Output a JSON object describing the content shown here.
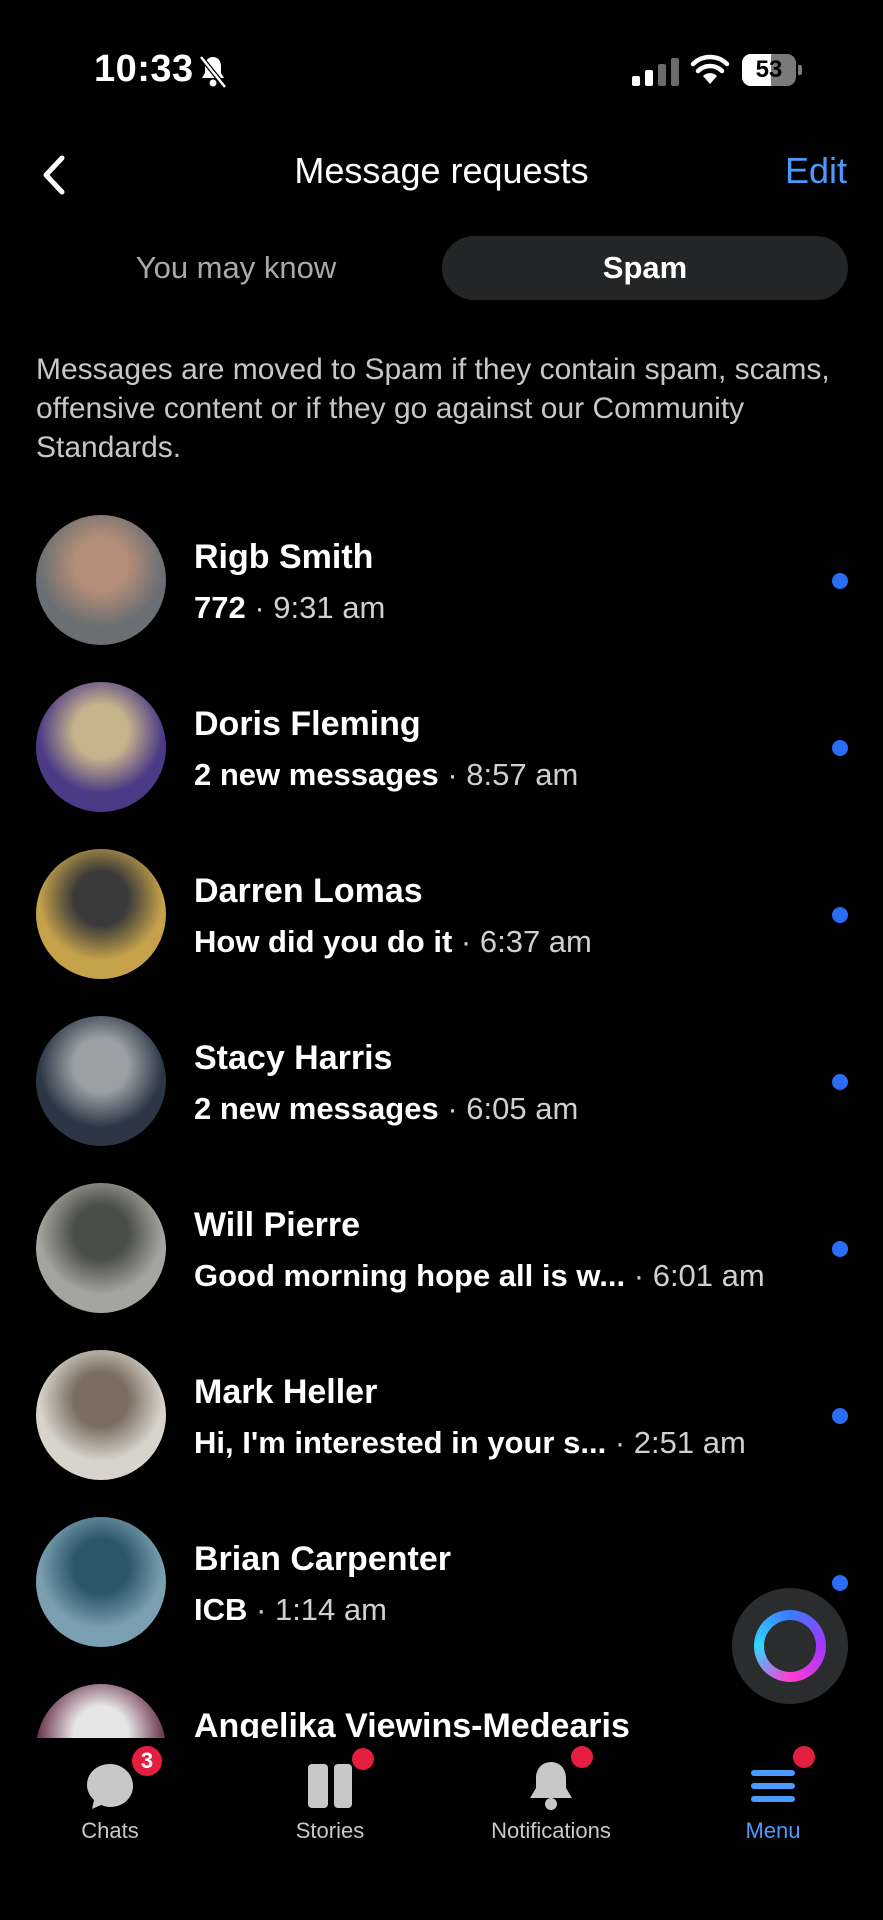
{
  "status": {
    "time": "10:33",
    "battery": "53",
    "battery_level": 0.53
  },
  "header": {
    "title": "Message requests",
    "edit_label": "Edit"
  },
  "tabs": {
    "left": "You may know",
    "right": "Spam"
  },
  "notice": "Messages are moved to Spam if they contain spam, scams, offensive content or if they go against our Community Standards.",
  "conversations": [
    {
      "name": "Rigb Smith",
      "preview": "772",
      "time": "9:31 am",
      "unread": true,
      "avatar_colors": [
        "#6b6f73",
        "#b38d77"
      ]
    },
    {
      "name": "Doris Fleming",
      "preview": "2 new messages",
      "time": "8:57 am",
      "unread": true,
      "avatar_colors": [
        "#4b3a86",
        "#c6b38b"
      ]
    },
    {
      "name": "Darren Lomas",
      "preview": "How did you do it",
      "time": "6:37 am",
      "unread": true,
      "avatar_colors": [
        "#c5a24a",
        "#3a3a3a"
      ]
    },
    {
      "name": "Stacy Harris",
      "preview": "2 new messages",
      "time": "6:05 am",
      "unread": true,
      "avatar_colors": [
        "#2c3645",
        "#9aa1a6"
      ]
    },
    {
      "name": "Will Pierre",
      "preview": "Good morning hope all is w...",
      "time": "6:01 am",
      "unread": true,
      "avatar_colors": [
        "#a4a4a0",
        "#4a4e44"
      ]
    },
    {
      "name": "Mark Heller",
      "preview": "Hi,  I'm interested in your s...",
      "time": "2:51 am",
      "unread": true,
      "avatar_colors": [
        "#d8d4cc",
        "#7b6d61"
      ]
    },
    {
      "name": "Brian Carpenter",
      "preview": "ICB",
      "time": "1:14 am",
      "unread": true,
      "avatar_colors": [
        "#7a9fb0",
        "#2b5568"
      ]
    },
    {
      "name": "Angelika Viewins-Medearis",
      "preview": "",
      "time": "",
      "unread": false,
      "avatar_colors": [
        "#6e3a52",
        "#e6e6e6"
      ]
    }
  ],
  "nav": {
    "chats": {
      "label": "Chats",
      "badge": "3"
    },
    "stories": {
      "label": "Stories"
    },
    "notifications": {
      "label": "Notifications"
    },
    "menu": {
      "label": "Menu"
    }
  },
  "colors": {
    "accent": "#4b9bff",
    "unread_dot": "#2a6cf6",
    "badge": "#e41e3f"
  }
}
